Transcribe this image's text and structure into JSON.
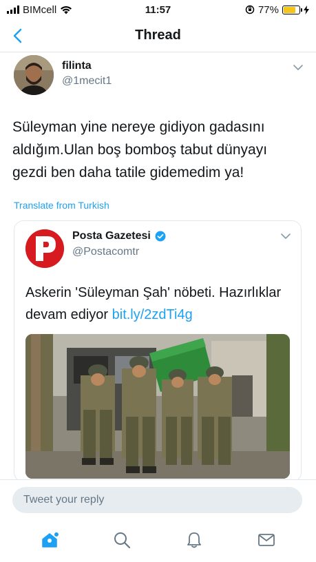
{
  "status_bar": {
    "carrier": "BIMcell",
    "time": "11:57",
    "battery_percent": "77%",
    "battery_level": 0.77
  },
  "header": {
    "title": "Thread"
  },
  "tweet": {
    "name": "filinta",
    "handle": "@1mecit1",
    "text": "Süleyman yine nereye gidiyon gadasını aldığım.Ulan boş bomboş tabut dünyayı gezdi ben daha tatile gidemedim ya!",
    "translate_label": "Translate from Turkish"
  },
  "quoted_tweet": {
    "name": "Posta Gazetesi",
    "handle": "@Postacomtr",
    "text": "Askerin 'Süleyman Şah' nöbeti. Hazırlıklar devam ediyor ",
    "link": "bit.ly/2zdTi4g",
    "logo_letter": "P",
    "verified": true
  },
  "reply": {
    "placeholder": "Tweet your reply"
  },
  "colors": {
    "accent": "#1da1f2",
    "text_primary": "#14171a",
    "text_secondary": "#657786",
    "posta_red": "#d71920",
    "coffin_green": "#2e8b3a"
  },
  "tabs": [
    {
      "icon": "home-icon"
    },
    {
      "icon": "search-icon"
    },
    {
      "icon": "bell-icon"
    },
    {
      "icon": "mail-icon"
    }
  ]
}
